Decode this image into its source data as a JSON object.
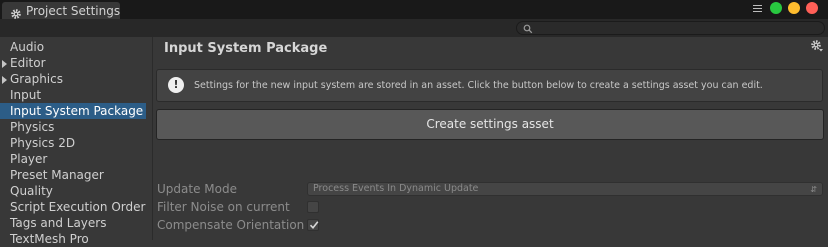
{
  "window": {
    "title": "Project Settings",
    "icon": "gear-icon",
    "controls": [
      {
        "name": "close",
        "color": "#ff5f57"
      },
      {
        "name": "minimize",
        "color": "#febc2e"
      },
      {
        "name": "maximize",
        "color": "#28c840"
      }
    ]
  },
  "search": {
    "placeholder": "",
    "icon": "search-icon"
  },
  "sidebar": {
    "items": [
      {
        "label": "Audio",
        "selected": false,
        "arrow": false
      },
      {
        "label": "Editor",
        "selected": false,
        "arrow": true
      },
      {
        "label": "Graphics",
        "selected": false,
        "arrow": true
      },
      {
        "label": "Input",
        "selected": false,
        "arrow": false
      },
      {
        "label": "Input System Package",
        "selected": true,
        "arrow": false
      },
      {
        "label": "Physics",
        "selected": false,
        "arrow": false
      },
      {
        "label": "Physics 2D",
        "selected": false,
        "arrow": false
      },
      {
        "label": "Player",
        "selected": false,
        "arrow": false
      },
      {
        "label": "Preset Manager",
        "selected": false,
        "arrow": false
      },
      {
        "label": "Quality",
        "selected": false,
        "arrow": false
      },
      {
        "label": "Script Execution Order",
        "selected": false,
        "arrow": false
      },
      {
        "label": "Tags and Layers",
        "selected": false,
        "arrow": false
      },
      {
        "label": "TextMesh Pro",
        "selected": false,
        "arrow": false
      }
    ]
  },
  "main": {
    "title": "Input System Package",
    "info_message": "Settings for the new input system are stored in an asset. Click the button below to create a settings asset you can edit.",
    "create_button_label": "Create settings asset",
    "fields": {
      "update_mode": {
        "label": "Update Mode",
        "value": "Process Events In Dynamic Update"
      },
      "filter_noise": {
        "label": "Filter Noise on current",
        "checked": false
      },
      "compensate_orientation": {
        "label": "Compensate Orientation",
        "checked": true
      }
    }
  },
  "colors": {
    "selection": "#2c5d87",
    "background": "#383838",
    "titlebar": "#191919"
  }
}
